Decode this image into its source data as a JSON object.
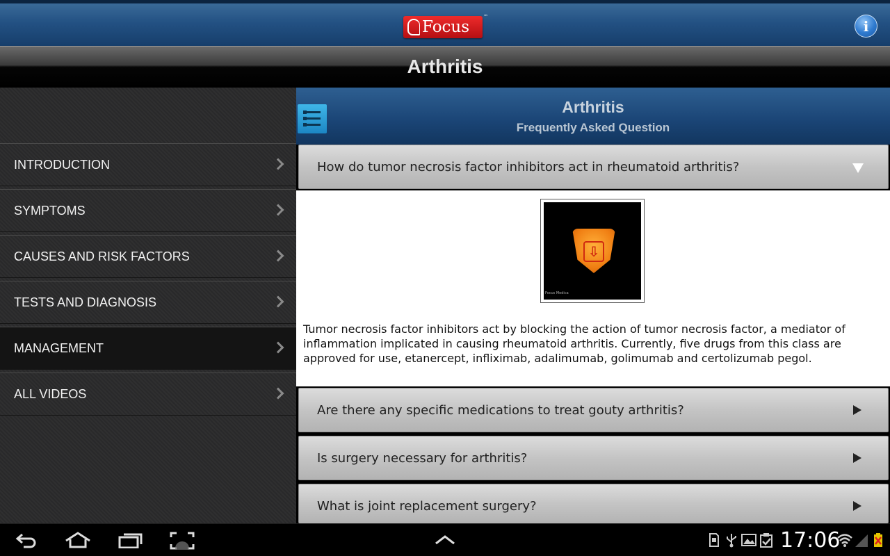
{
  "header": {
    "logo_text": "Focus",
    "logo_tm": "™",
    "info_label": "i"
  },
  "title_bar": {
    "title": "Arthritis"
  },
  "sidebar": {
    "items": [
      {
        "label": "INTRODUCTION"
      },
      {
        "label": "SYMPTOMS"
      },
      {
        "label": "CAUSES AND RISK FACTORS"
      },
      {
        "label": "TESTS AND DIAGNOSIS"
      },
      {
        "label": "MANAGEMENT",
        "active": true
      },
      {
        "label": "ALL VIDEOS"
      }
    ]
  },
  "content": {
    "title": "Arthritis",
    "subtitle": "Frequently Asked Question",
    "faqs": [
      {
        "question": "How do tumor necrosis factor inhibitors act in rheumatoid arthritis?",
        "expanded": true
      },
      {
        "question": "Are there any specific medications to treat gouty arthritis?",
        "expanded": false
      },
      {
        "question": "Is surgery necessary for arthritis?",
        "expanded": false
      },
      {
        "question": "What is joint replacement surgery?",
        "expanded": false
      }
    ],
    "answer": {
      "video_caption": "Focus Medica",
      "text": "Tumor necrosis factor inhibitors act by blocking the action of tumor necrosis factor, a mediator of inflammation implicated in causing rheumatoid arthritis. Currently, five drugs from this class are approved for use, etanercept, infliximab, adalimumab, golimumab and certolizumab pegol."
    }
  },
  "system_bar": {
    "time": "17:06",
    "nav_icons": [
      "back-icon",
      "home-icon",
      "recent-apps-icon",
      "screenshot-icon",
      "up-arrow-icon"
    ],
    "status_icons": [
      "sd-card-icon",
      "usb-icon",
      "gallery-icon",
      "clipboard-check-icon",
      "wifi-icon",
      "signal-icon",
      "battery-icon"
    ],
    "colors": {
      "battery": "#e6c500",
      "battery_x": "#e02020"
    }
  }
}
